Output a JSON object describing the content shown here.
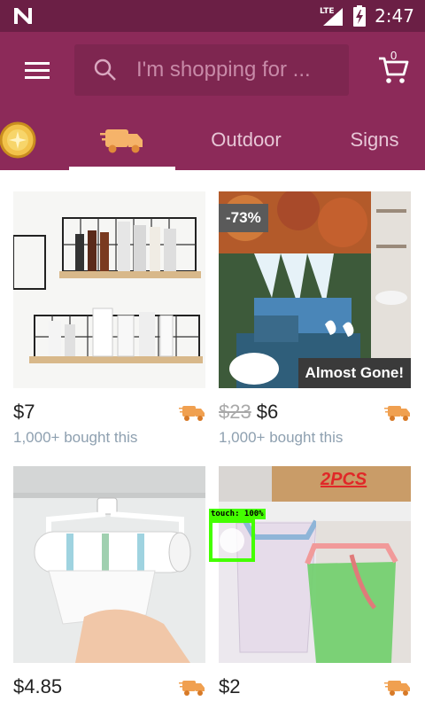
{
  "status_bar": {
    "time": "2:47",
    "network": "LTE"
  },
  "search": {
    "placeholder": "I'm shopping for ..."
  },
  "cart": {
    "count": "0"
  },
  "tabs": [
    {
      "label": "",
      "icon": "coin-icon"
    },
    {
      "label": "",
      "icon": "truck-icon",
      "active": true
    },
    {
      "label": "Outdoor"
    },
    {
      "label": "Signs"
    }
  ],
  "products": [
    {
      "price": "$7",
      "bought": "1,000+ bought this",
      "image": "wire-wall-shelves"
    },
    {
      "old_price": "$23",
      "price": "$6",
      "bought": "1,000+ bought this",
      "discount": "-73%",
      "stock_note": "Almost Gone!",
      "image": "waterfall-shower-curtain"
    },
    {
      "price": "$4.85",
      "image": "paper-towel-holder"
    },
    {
      "price": "$2",
      "overlay_text": "2PCS",
      "image": "cabinet-trash-bag-holder"
    }
  ],
  "touch_indicator": {
    "label": "touch: 100%"
  },
  "colors": {
    "statusbar": "#6b1f45",
    "appbar": "#8c2a59",
    "truck": "#f0a050"
  }
}
